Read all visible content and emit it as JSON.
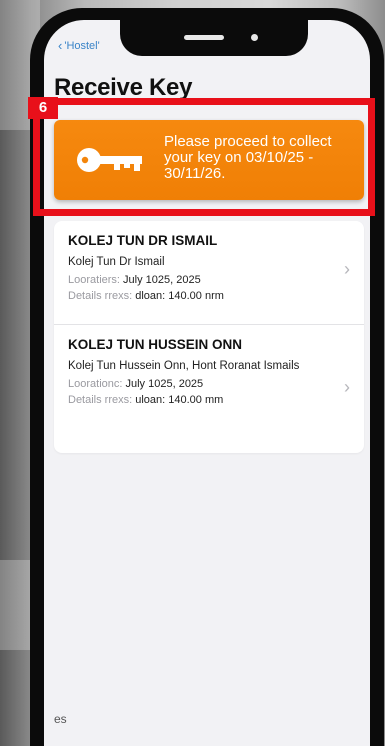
{
  "nav": {
    "back_label": "'Hostel'"
  },
  "page": {
    "title": "Receive Key"
  },
  "annotation": {
    "step_number": "6"
  },
  "banner": {
    "message": "Please proceed to collect your key on 03/10/25 - 30/11/26.",
    "icon": "key-icon",
    "color": "#f5860c"
  },
  "hostels": [
    {
      "name": "KOLEJ TUN DR ISMAIL",
      "subtitle": "Kolej Tun Dr Ismail",
      "location_label": "Looratiers:",
      "location_value": "July 1025, 2025",
      "details_label": "Details rrexs:",
      "details_value": "dloan: 140.00 nrm"
    },
    {
      "name": "KOLEJ TUN HUSSEIN ONN",
      "subtitle": "Kolej Tun Hussein Onn, Hont Roranat Ismails",
      "location_label": "Loorationc:",
      "location_value": "July 1025, 2025",
      "details_label": "Details rrexs:",
      "details_value": "uloan: 140.00 mm"
    }
  ],
  "bottom": {
    "tab_fragment": "es"
  },
  "colors": {
    "highlight": "#e8101a",
    "link": "#3a84c8"
  }
}
